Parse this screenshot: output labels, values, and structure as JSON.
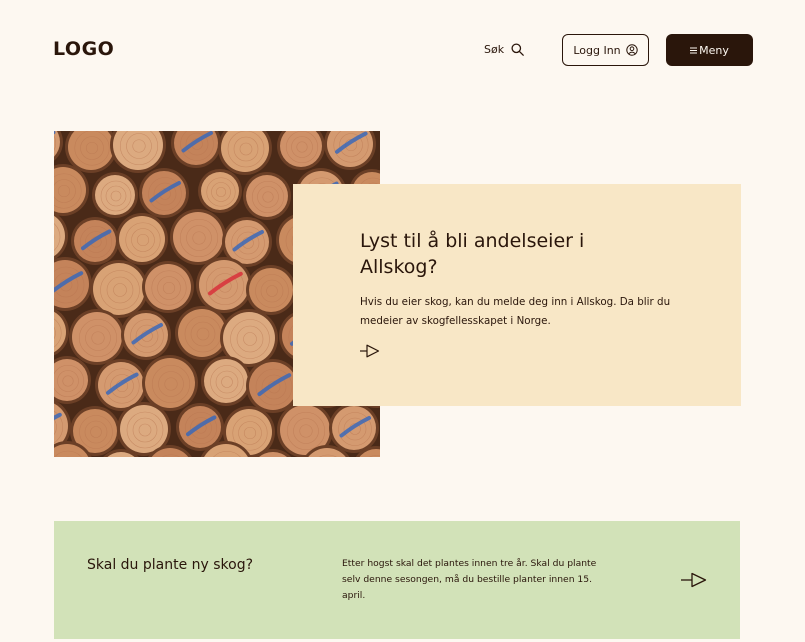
{
  "header": {
    "logo": "LOGO",
    "search_label": "Søk",
    "login_label": "Logg Inn",
    "menu_label": "Meny"
  },
  "hero": {
    "title": "Lyst til å bli andelseier i Allskog?",
    "text": "Hvis du eier skog, kan du melde deg inn i Allskog. Da blir du medeier av skogfellesskapet i Norge."
  },
  "plant": {
    "title": "Skal du plante ny skog?",
    "text": "Etter hogst skal det plantes innen tre år. Skal du plante selv denne sesongen, må du bestille planter innen 15. april."
  },
  "icons": {
    "search": "search-icon",
    "user": "user-circle-icon",
    "menu": "hamburger-icon",
    "arrow": "arrow-right-icon"
  },
  "colors": {
    "background": "#fdf8f1",
    "dark": "#2a160b",
    "hero_card": "#f8e7c6",
    "plant_card": "#d2e2b8"
  }
}
